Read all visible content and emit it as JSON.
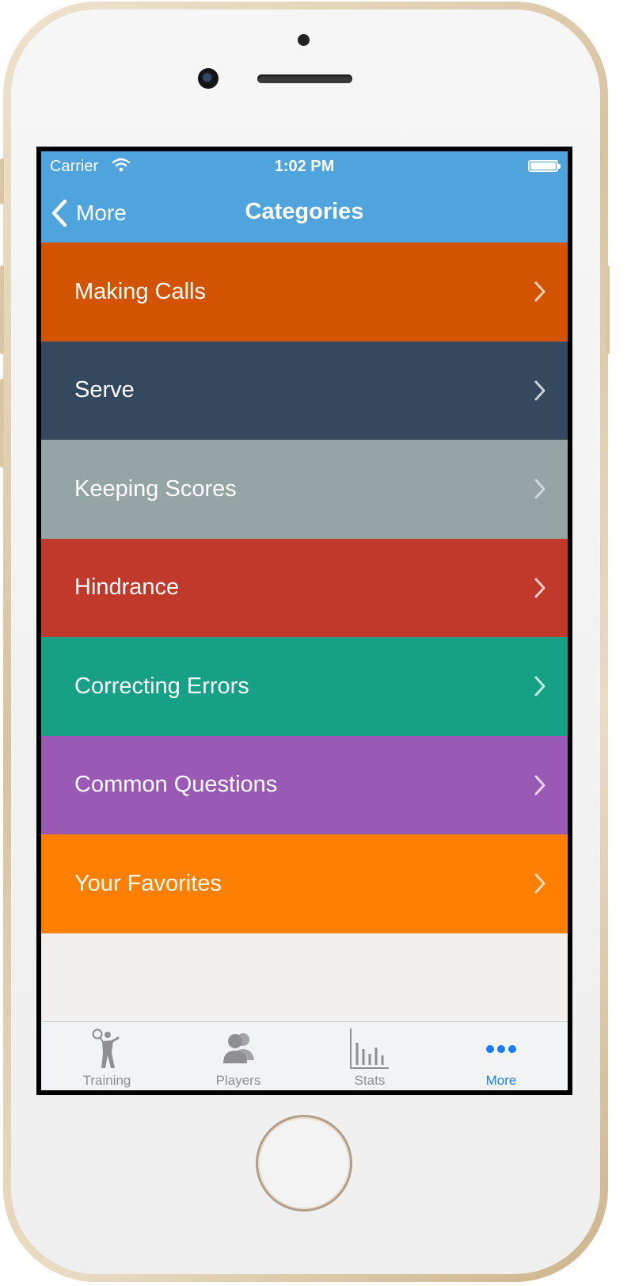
{
  "status_bar": {
    "carrier": "Carrier",
    "time": "1:02 PM"
  },
  "nav": {
    "back_label": "More",
    "title": "Categories"
  },
  "categories": [
    {
      "label": "Making Calls",
      "color": "#d35400"
    },
    {
      "label": "Serve",
      "color": "#34495e"
    },
    {
      "label": "Keeping Scores",
      "color": "#95a5a6"
    },
    {
      "label": "Hindrance",
      "color": "#c0392b"
    },
    {
      "label": "Correcting Errors",
      "color": "#16a085"
    },
    {
      "label": "Common Questions",
      "color": "#9b59b6"
    },
    {
      "label": "Your Favorites",
      "color": "#ff7f00"
    }
  ],
  "tabbar": {
    "tabs": [
      {
        "label": "Training",
        "icon": "tennis-player-icon"
      },
      {
        "label": "Players",
        "icon": "people-icon"
      },
      {
        "label": "Stats",
        "icon": "bar-chart-icon"
      },
      {
        "label": "More",
        "icon": "more-dots-icon",
        "active": true
      }
    ]
  },
  "colors": {
    "nav_bar": "#4fa4de",
    "tab_active": "#1a7cf5",
    "tab_inactive": "#8e8e93"
  }
}
